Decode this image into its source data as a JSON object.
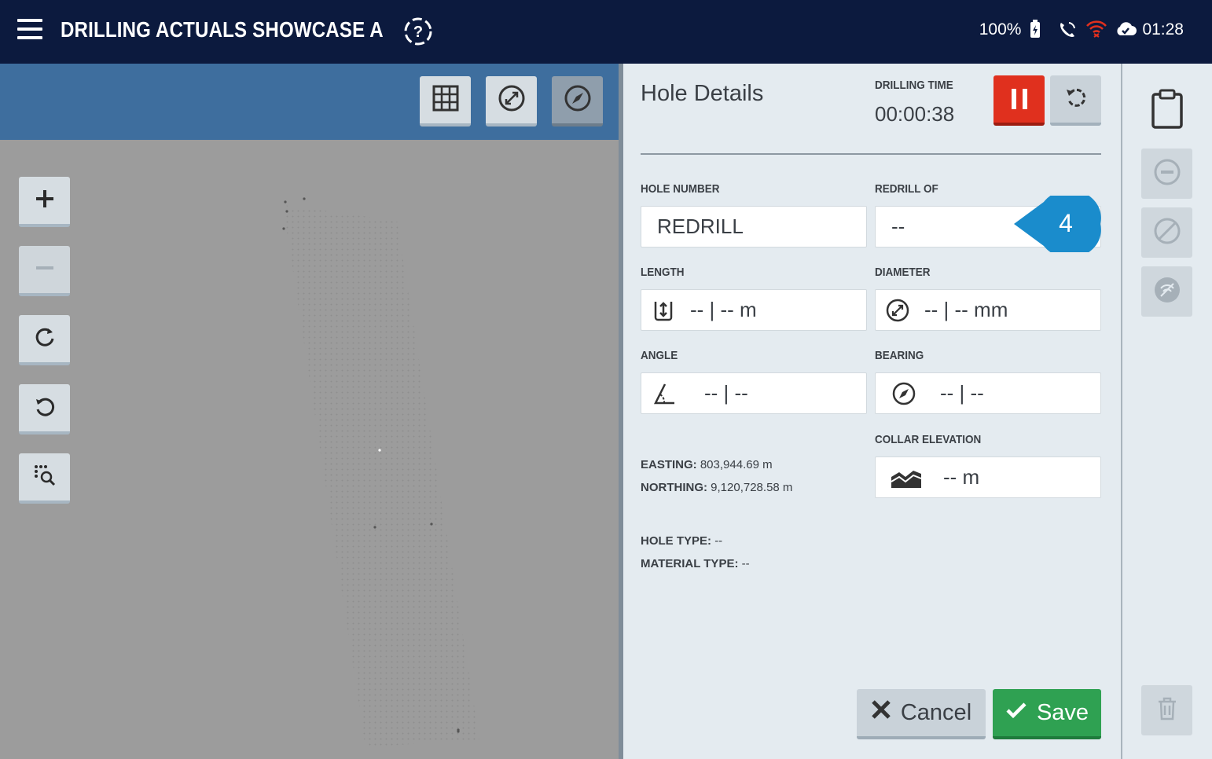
{
  "header": {
    "title": "DRILLING ACTUALS SHOWCASE A",
    "battery": "100%",
    "time": "01:28",
    "icons": [
      "menu-icon",
      "help-icon",
      "battery-icon",
      "phone-icon",
      "wifi-icon",
      "cloud-sync-icon"
    ]
  },
  "map": {
    "toolbar_icons": [
      "grid-view-icon",
      "diameter-icon",
      "compass-icon"
    ],
    "controls": [
      "zoom-in-icon",
      "zoom-out-icon",
      "rotate-clockwise-icon",
      "rotate-counterclockwise-icon",
      "zoom-to-holes-icon"
    ]
  },
  "details": {
    "title": "Hole Details",
    "drilling_time_label": "DRILLING TIME",
    "drilling_time": "00:00:38",
    "hole_number_label": "HOLE NUMBER",
    "hole_number": "REDRILL",
    "redrill_of_label": "REDRILL OF",
    "redrill_of": "--",
    "length_label": "LENGTH",
    "length": "-- | -- m",
    "diameter_label": "DIAMETER",
    "diameter": "-- | -- mm",
    "angle_label": "ANGLE",
    "angle": "-- | --",
    "bearing_label": "BEARING",
    "bearing": "-- | --",
    "collar_elevation_label": "COLLAR ELEVATION",
    "collar_elevation": "-- m",
    "easting_label": "EASTING:",
    "easting": "803,944.69 m",
    "northing_label": "NORTHING:",
    "northing": "9,120,728.58 m",
    "hole_type_label": "HOLE TYPE:",
    "hole_type": "--",
    "material_type_label": "MATERIAL TYPE:",
    "material_type": "--",
    "cancel_label": "Cancel",
    "save_label": "Save"
  },
  "callout": {
    "number": "4",
    "color": "#1a8ccc"
  },
  "rail": {
    "icons": [
      "clipboard-icon",
      "minus-circle-icon",
      "slash-circle-icon",
      "no-signal-icon",
      "trash-icon"
    ]
  },
  "colors": {
    "header_bg": "#0c1a3e",
    "map_toolbar": "#3e6e9e",
    "pause": "#e0301e",
    "save": "#2fa152",
    "wifi": "#e0301e"
  }
}
